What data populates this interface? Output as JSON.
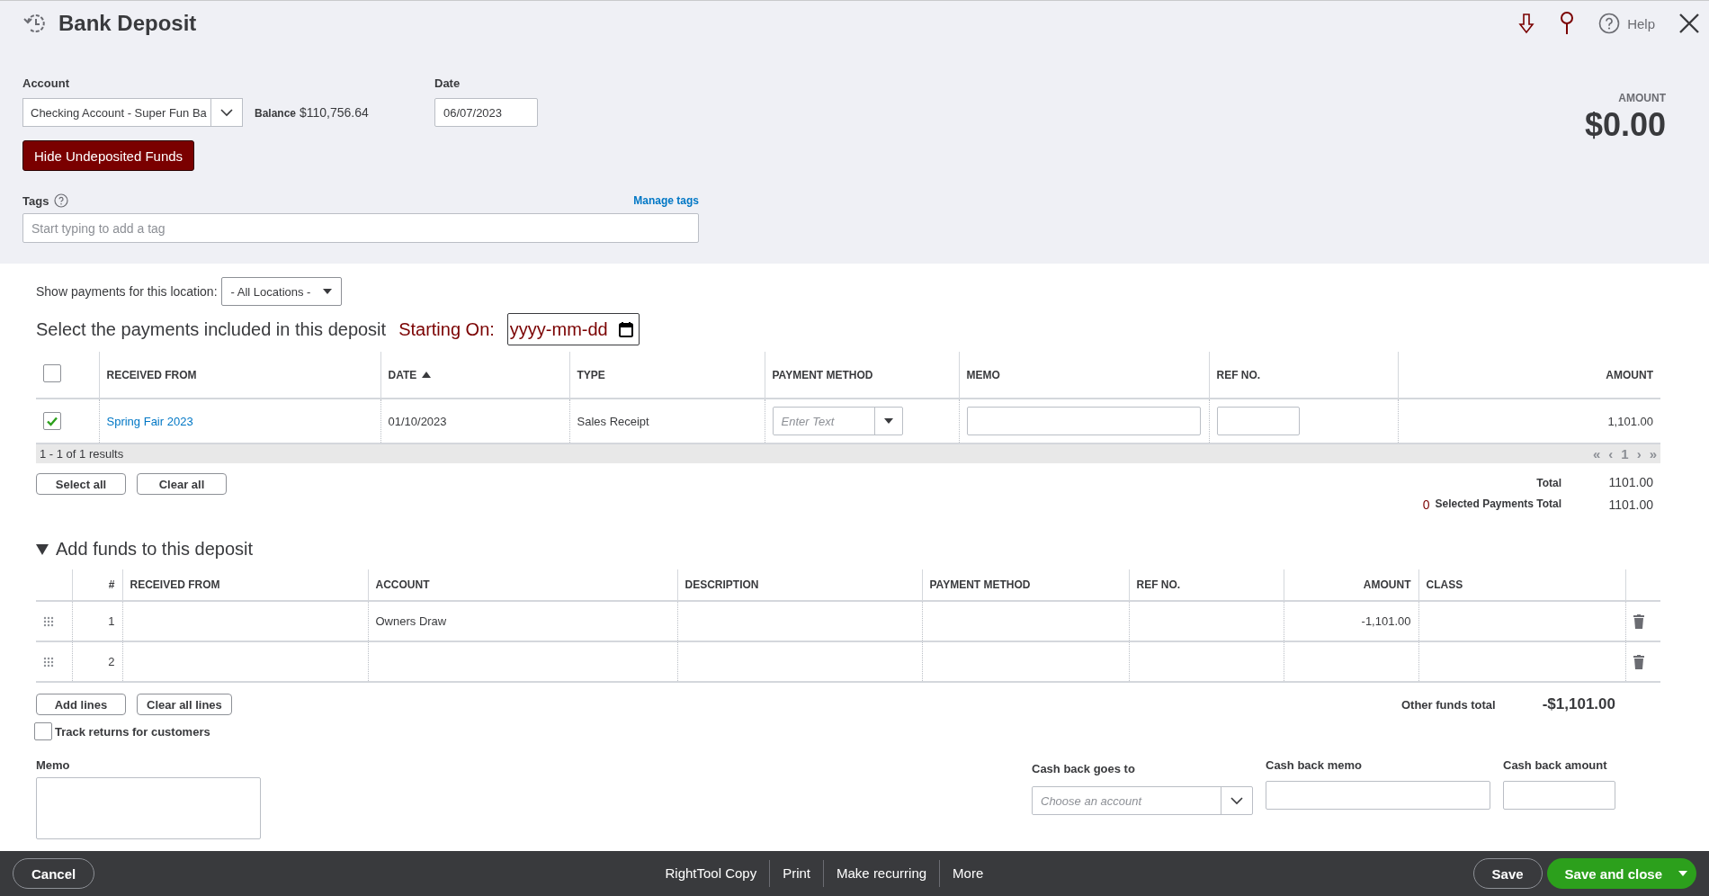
{
  "header": {
    "title": "Bank Deposit",
    "help": "Help"
  },
  "form": {
    "account_label": "Account",
    "account_value": "Checking Account - Super Fun Ba",
    "balance_label": "Balance",
    "balance": "$110,756.64",
    "date_label": "Date",
    "date_value": "06/07/2023",
    "hide_button": "Hide Undeposited Funds",
    "tags_label": "Tags",
    "manage_tags": "Manage tags",
    "tags_placeholder": "Start typing to add a tag",
    "amount_label": "AMOUNT",
    "amount": "$0.00"
  },
  "payments": {
    "location_label": "Show payments for this location:",
    "location_value": "- All Locations -",
    "heading": "Select the payments included in this deposit",
    "starting_on_label": "Starting On:",
    "starting_on_placeholder": "yyyy-mm-dd",
    "select_all_checked": false,
    "columns": [
      {
        "label": "RECEIVED FROM",
        "sorted": false
      },
      {
        "label": "DATE",
        "sorted": true
      },
      {
        "label": "TYPE",
        "sorted": false
      },
      {
        "label": "PAYMENT METHOD",
        "sorted": false
      },
      {
        "label": "MEMO",
        "sorted": false
      },
      {
        "label": "REF NO.",
        "sorted": false
      },
      {
        "label": "AMOUNT",
        "sorted": false
      }
    ],
    "rows": [
      {
        "checked": true,
        "received_from": "Spring Fair 2023",
        "date": "01/10/2023",
        "type": "Sales Receipt",
        "payment_method_placeholder": "Enter Text",
        "amount": "1,101.00"
      }
    ],
    "results": "1 - 1 of 1 results",
    "pager": [
      "«",
      "‹",
      "1",
      "›",
      "»"
    ],
    "buttons": [
      "Select all",
      "Clear all"
    ],
    "total_label": "Total",
    "total": "1101.00",
    "selected_count": "0",
    "selected_label": "Selected Payments Total",
    "selected_total": "1101.00"
  },
  "funds": {
    "heading": "Add funds to this deposit",
    "expanded": true,
    "columns": [
      "#",
      "RECEIVED FROM",
      "ACCOUNT",
      "DESCRIPTION",
      "PAYMENT METHOD",
      "REF NO.",
      "AMOUNT",
      "CLASS"
    ],
    "rows": [
      {
        "number": "1",
        "account": "Owners Draw",
        "amount": "-1,101.00"
      },
      {
        "number": "2",
        "account": "",
        "amount": ""
      }
    ],
    "buttons": [
      "Add lines",
      "Clear all lines"
    ],
    "other_total_label": "Other funds total",
    "other_total": "-$1,101.00",
    "track_returns": {
      "label": "Track returns for customers",
      "checked": false
    },
    "memo_label": "Memo",
    "cash_back_to_label": "Cash back goes to",
    "cash_back_to_placeholder": "Choose an account",
    "cash_back_memo_label": "Cash back memo",
    "cash_back_amount_label": "Cash back amount"
  },
  "footer": {
    "cancel": "Cancel",
    "actions": [
      "RightTool Copy",
      "Print",
      "Make recurring",
      "More"
    ],
    "save": "Save",
    "save_close": "Save and close"
  }
}
